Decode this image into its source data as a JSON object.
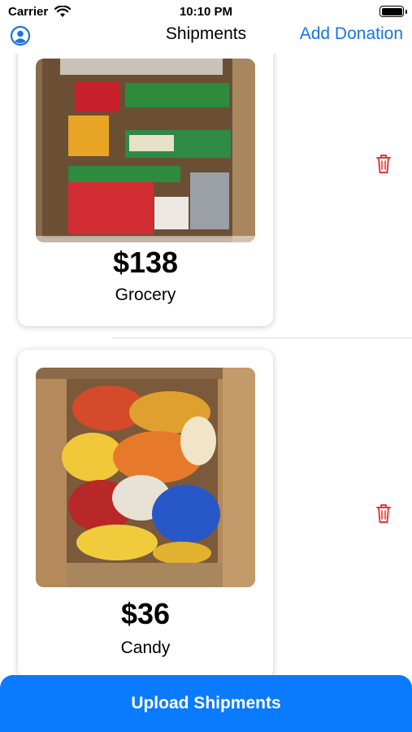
{
  "status_bar": {
    "carrier": "Carrier",
    "time": "10:10 PM"
  },
  "nav": {
    "title": "Shipments",
    "add_label": "Add Donation"
  },
  "shipments": [
    {
      "price": "$138",
      "category": "Grocery"
    },
    {
      "price": "$36",
      "category": "Candy"
    }
  ],
  "upload": {
    "label": "Upload Shipments"
  },
  "colors": {
    "accent": "#1a73e8",
    "button": "#0a7aff",
    "delete": "#e53935"
  }
}
